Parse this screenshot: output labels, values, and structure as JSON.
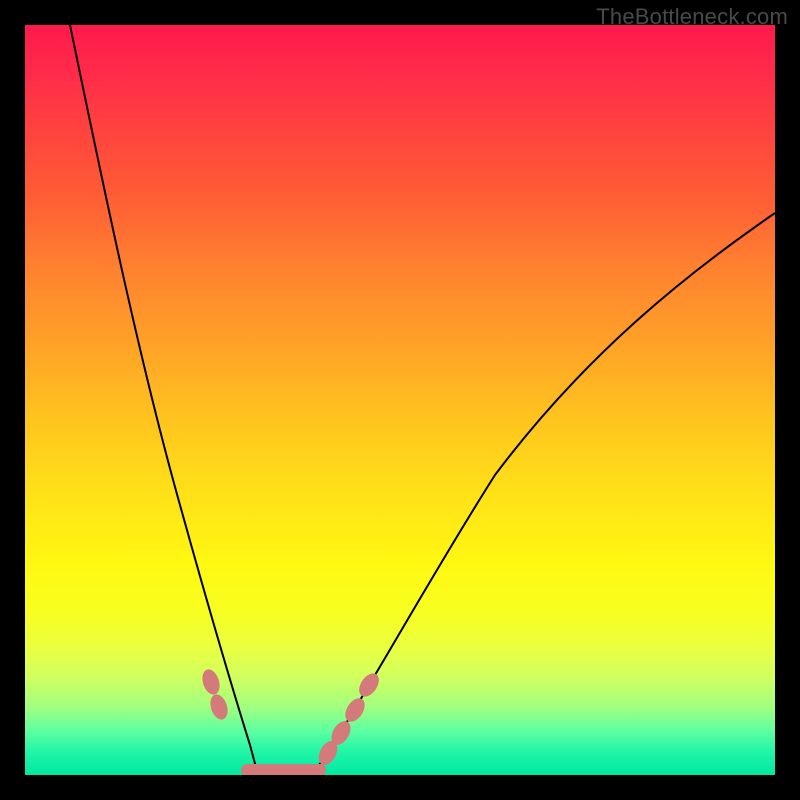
{
  "watermark": "TheBottleneck.com",
  "chart_data": {
    "type": "line",
    "title": "",
    "xlabel": "",
    "ylabel": "",
    "xlim": [
      0,
      100
    ],
    "ylim": [
      0,
      100
    ],
    "series": [
      {
        "name": "left-curve",
        "x": [
          6,
          8,
          10,
          12,
          14,
          16,
          18,
          20,
          22,
          24,
          26,
          28,
          30
        ],
        "y": [
          100,
          90,
          78,
          66,
          55,
          45,
          36,
          28,
          20,
          13,
          8,
          4,
          0
        ]
      },
      {
        "name": "right-curve",
        "x": [
          38,
          40,
          44,
          48,
          52,
          56,
          60,
          66,
          72,
          80,
          88,
          96,
          100
        ],
        "y": [
          0,
          3,
          10,
          18,
          26,
          33,
          40,
          48,
          55,
          62,
          68,
          73,
          75
        ]
      }
    ],
    "flat_region": {
      "x_start": 30,
      "x_end": 38,
      "y": 0
    },
    "markers": [
      {
        "series": "left-curve",
        "x": 24.5,
        "y": 12
      },
      {
        "series": "left-curve",
        "x": 25.5,
        "y": 9
      },
      {
        "series": "flat",
        "x": 30,
        "y": 0
      },
      {
        "series": "flat",
        "x": 34,
        "y": 0
      },
      {
        "series": "flat",
        "x": 38,
        "y": 0
      },
      {
        "series": "right-curve",
        "x": 40,
        "y": 3
      },
      {
        "series": "right-curve",
        "x": 41.5,
        "y": 6
      },
      {
        "series": "right-curve",
        "x": 43.5,
        "y": 9.5
      },
      {
        "series": "right-curve",
        "x": 45,
        "y": 12.5
      }
    ],
    "gradient_note": "background encodes value: red=high bottleneck, green=low bottleneck"
  }
}
